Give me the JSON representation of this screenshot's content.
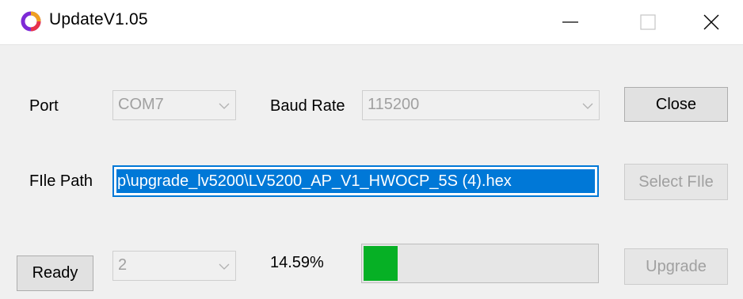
{
  "window": {
    "title": "UpdateV1.05"
  },
  "port": {
    "label": "Port",
    "value": "COM7"
  },
  "baud": {
    "label": "Baud Rate",
    "value": "115200"
  },
  "close_button": "Close",
  "file_path": {
    "label": "FIle Path",
    "value": "p\\upgrade_lv5200\\LV5200_AP_V1_HWOCP_5S (4).hex"
  },
  "select_file_button": "Select FIle",
  "status_button": "Ready",
  "mode_select": {
    "value": "2"
  },
  "progress": {
    "text": "14.59%",
    "fraction": 0.1459
  },
  "upgrade_button": "Upgrade",
  "colors": {
    "progress_fill": "#06b025",
    "selection": "#0078d7",
    "disabled_text": "#a0a0a0"
  },
  "icons": [
    "app-logo-icon",
    "minimize-icon",
    "maximize-icon",
    "close-icon",
    "chevron-down-icon"
  ]
}
